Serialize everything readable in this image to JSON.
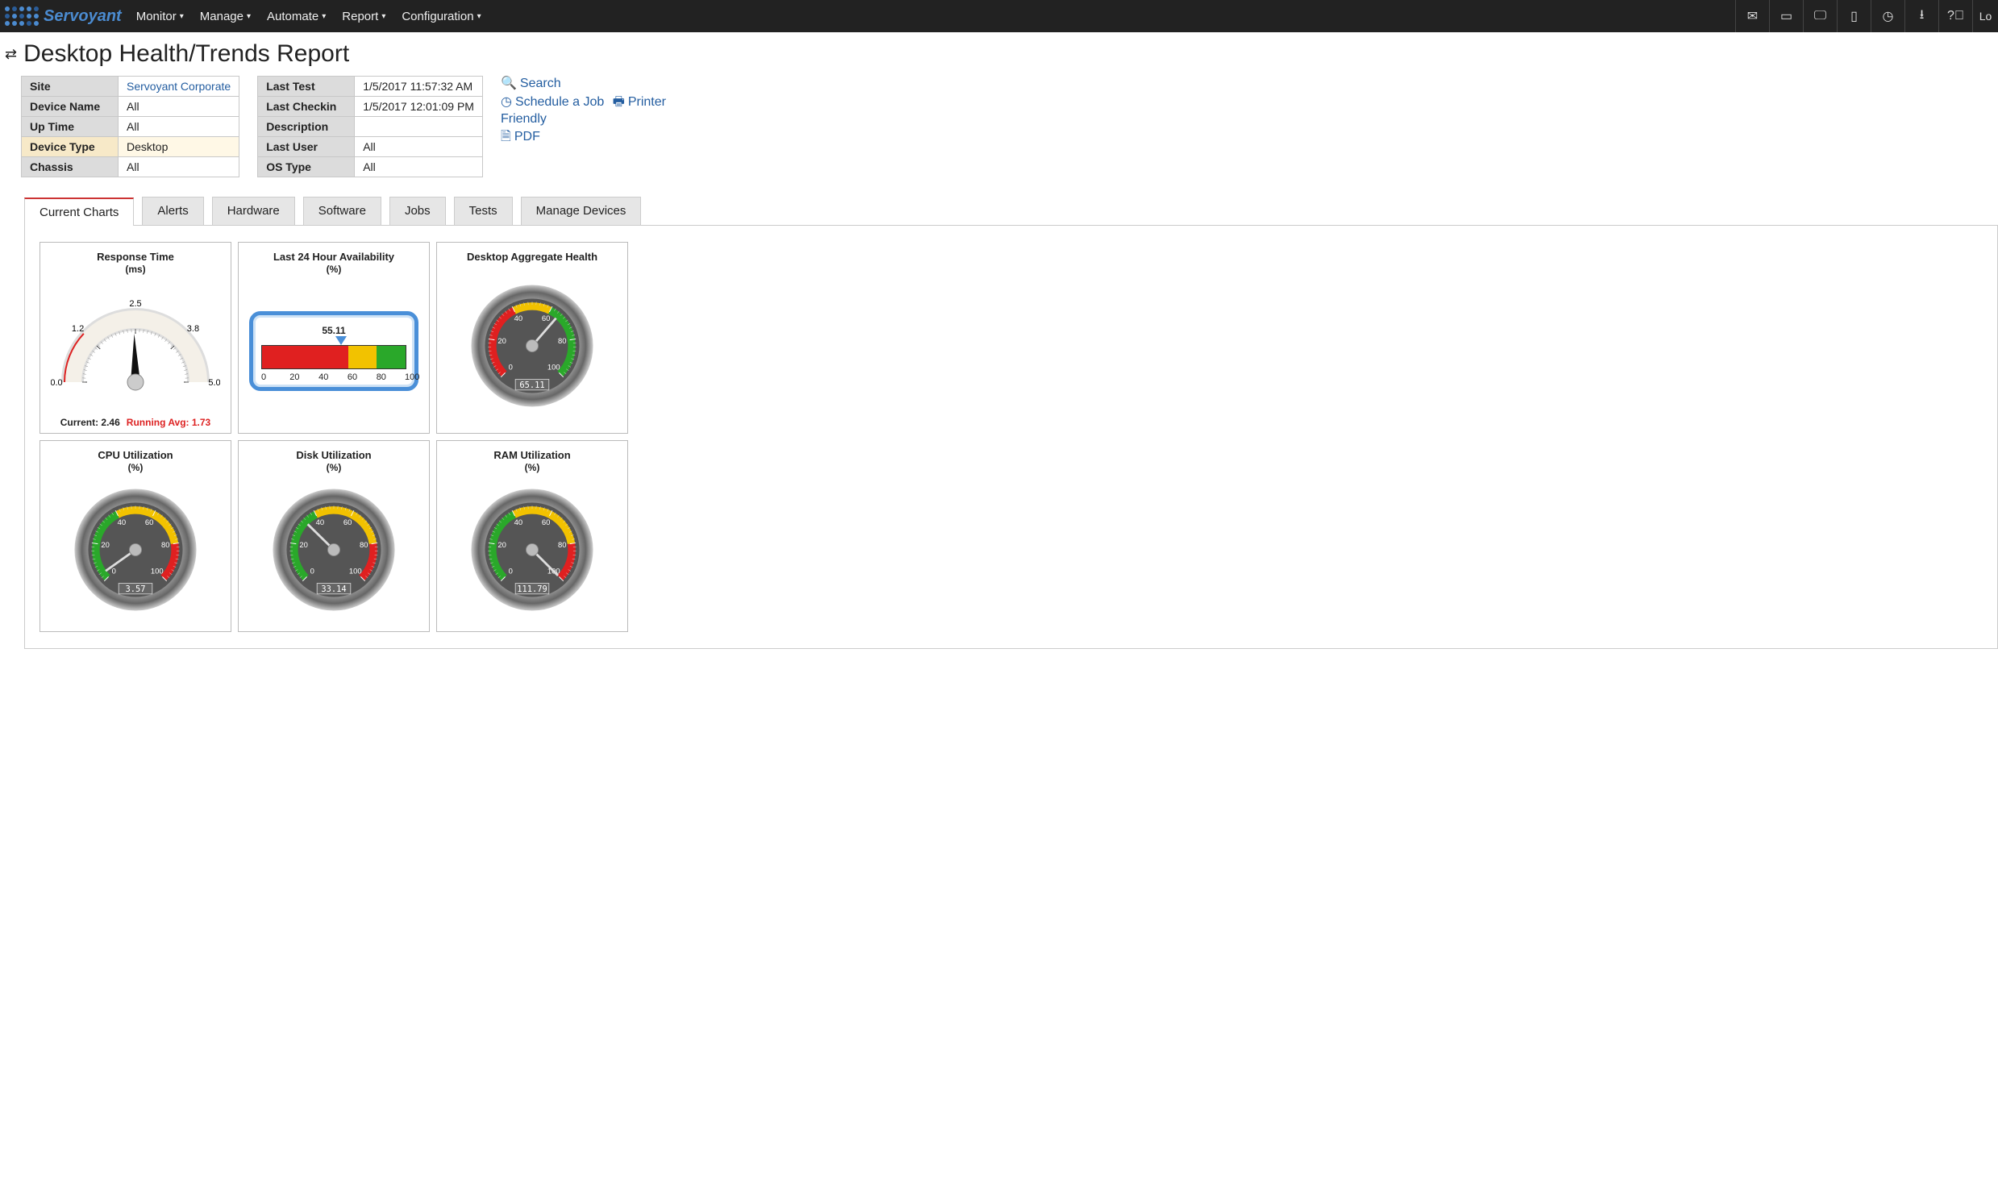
{
  "brand": "Servoyant",
  "nav": [
    "Monitor",
    "Manage",
    "Automate",
    "Report",
    "Configuration"
  ],
  "toolbar_right": {
    "lo": "Lo"
  },
  "page_title": "Desktop Health/Trends Report",
  "filters_left": [
    {
      "label": "Site",
      "value": "Servoyant Corporate",
      "link": true
    },
    {
      "label": "Device Name",
      "value": "All"
    },
    {
      "label": "Up Time",
      "value": "All"
    },
    {
      "label": "Device Type",
      "value": "Desktop",
      "highlight": true
    },
    {
      "label": "Chassis",
      "value": "All"
    }
  ],
  "filters_right": [
    {
      "label": "Last Test",
      "value": "1/5/2017 11:57:32 AM"
    },
    {
      "label": "Last Checkin",
      "value": "1/5/2017 12:01:09 PM"
    },
    {
      "label": "Description",
      "value": ""
    },
    {
      "label": "Last User",
      "value": "All"
    },
    {
      "label": "OS Type",
      "value": "All"
    }
  ],
  "actions": {
    "search": "Search",
    "schedule": "Schedule a Job",
    "printer": "Printer Friendly",
    "pdf": "PDF"
  },
  "tabs": [
    "Current Charts",
    "Alerts",
    "Hardware",
    "Software",
    "Jobs",
    "Tests",
    "Manage Devices"
  ],
  "active_tab": 0,
  "chart_data": [
    {
      "type": "gauge-half",
      "title": "Response Time",
      "unit": "(ms)",
      "min": 0.0,
      "max": 5.0,
      "ticks": [
        0.0,
        1.2,
        2.5,
        3.8,
        5.0
      ],
      "value": 2.46,
      "running_avg": 1.73,
      "zones": [
        {
          "from": 0.0,
          "to": 1.2,
          "color": "#d22"
        }
      ],
      "footer_current_label": "Current:",
      "footer_avg_label": "Running Avg:"
    },
    {
      "type": "linear",
      "title": "Last 24 Hour Availability",
      "unit": "(%)",
      "min": 0,
      "max": 100,
      "ticks": [
        0,
        20,
        40,
        60,
        80,
        100
      ],
      "value": 55.11,
      "bands": [
        {
          "from": 0,
          "to": 60,
          "color": "#e02020"
        },
        {
          "from": 60,
          "to": 80,
          "color": "#f2c200"
        },
        {
          "from": 80,
          "to": 100,
          "color": "#2aa82a"
        }
      ]
    },
    {
      "type": "gauge-round",
      "title": "Desktop Aggregate Health",
      "unit": "",
      "min": 0,
      "max": 100,
      "ticks": [
        0,
        20,
        40,
        60,
        80,
        100
      ],
      "value": 65.11,
      "bands": [
        {
          "from": 0,
          "to": 40,
          "color": "#e02020"
        },
        {
          "from": 40,
          "to": 60,
          "color": "#f2c200"
        },
        {
          "from": 60,
          "to": 100,
          "color": "#2aa82a"
        }
      ]
    },
    {
      "type": "gauge-round",
      "title": "CPU Utilization",
      "unit": "(%)",
      "min": 0,
      "max": 100,
      "ticks": [
        0,
        20,
        40,
        60,
        80,
        100
      ],
      "value": 3.57,
      "bands": [
        {
          "from": 0,
          "to": 40,
          "color": "#2aa82a"
        },
        {
          "from": 40,
          "to": 80,
          "color": "#f2c200"
        },
        {
          "from": 80,
          "to": 100,
          "color": "#e02020"
        }
      ]
    },
    {
      "type": "gauge-round",
      "title": "Disk Utilization",
      "unit": "(%)",
      "min": 0,
      "max": 100,
      "ticks": [
        0,
        20,
        40,
        60,
        80,
        100
      ],
      "value": 33.14,
      "bands": [
        {
          "from": 0,
          "to": 40,
          "color": "#2aa82a"
        },
        {
          "from": 40,
          "to": 80,
          "color": "#f2c200"
        },
        {
          "from": 80,
          "to": 100,
          "color": "#e02020"
        }
      ]
    },
    {
      "type": "gauge-round",
      "title": "RAM Utilization",
      "unit": "(%)",
      "min": 0,
      "max": 100,
      "ticks": [
        0,
        20,
        40,
        60,
        80,
        100
      ],
      "value": 111.79,
      "bands": [
        {
          "from": 0,
          "to": 40,
          "color": "#2aa82a"
        },
        {
          "from": 40,
          "to": 80,
          "color": "#f2c200"
        },
        {
          "from": 80,
          "to": 100,
          "color": "#e02020"
        }
      ]
    }
  ]
}
